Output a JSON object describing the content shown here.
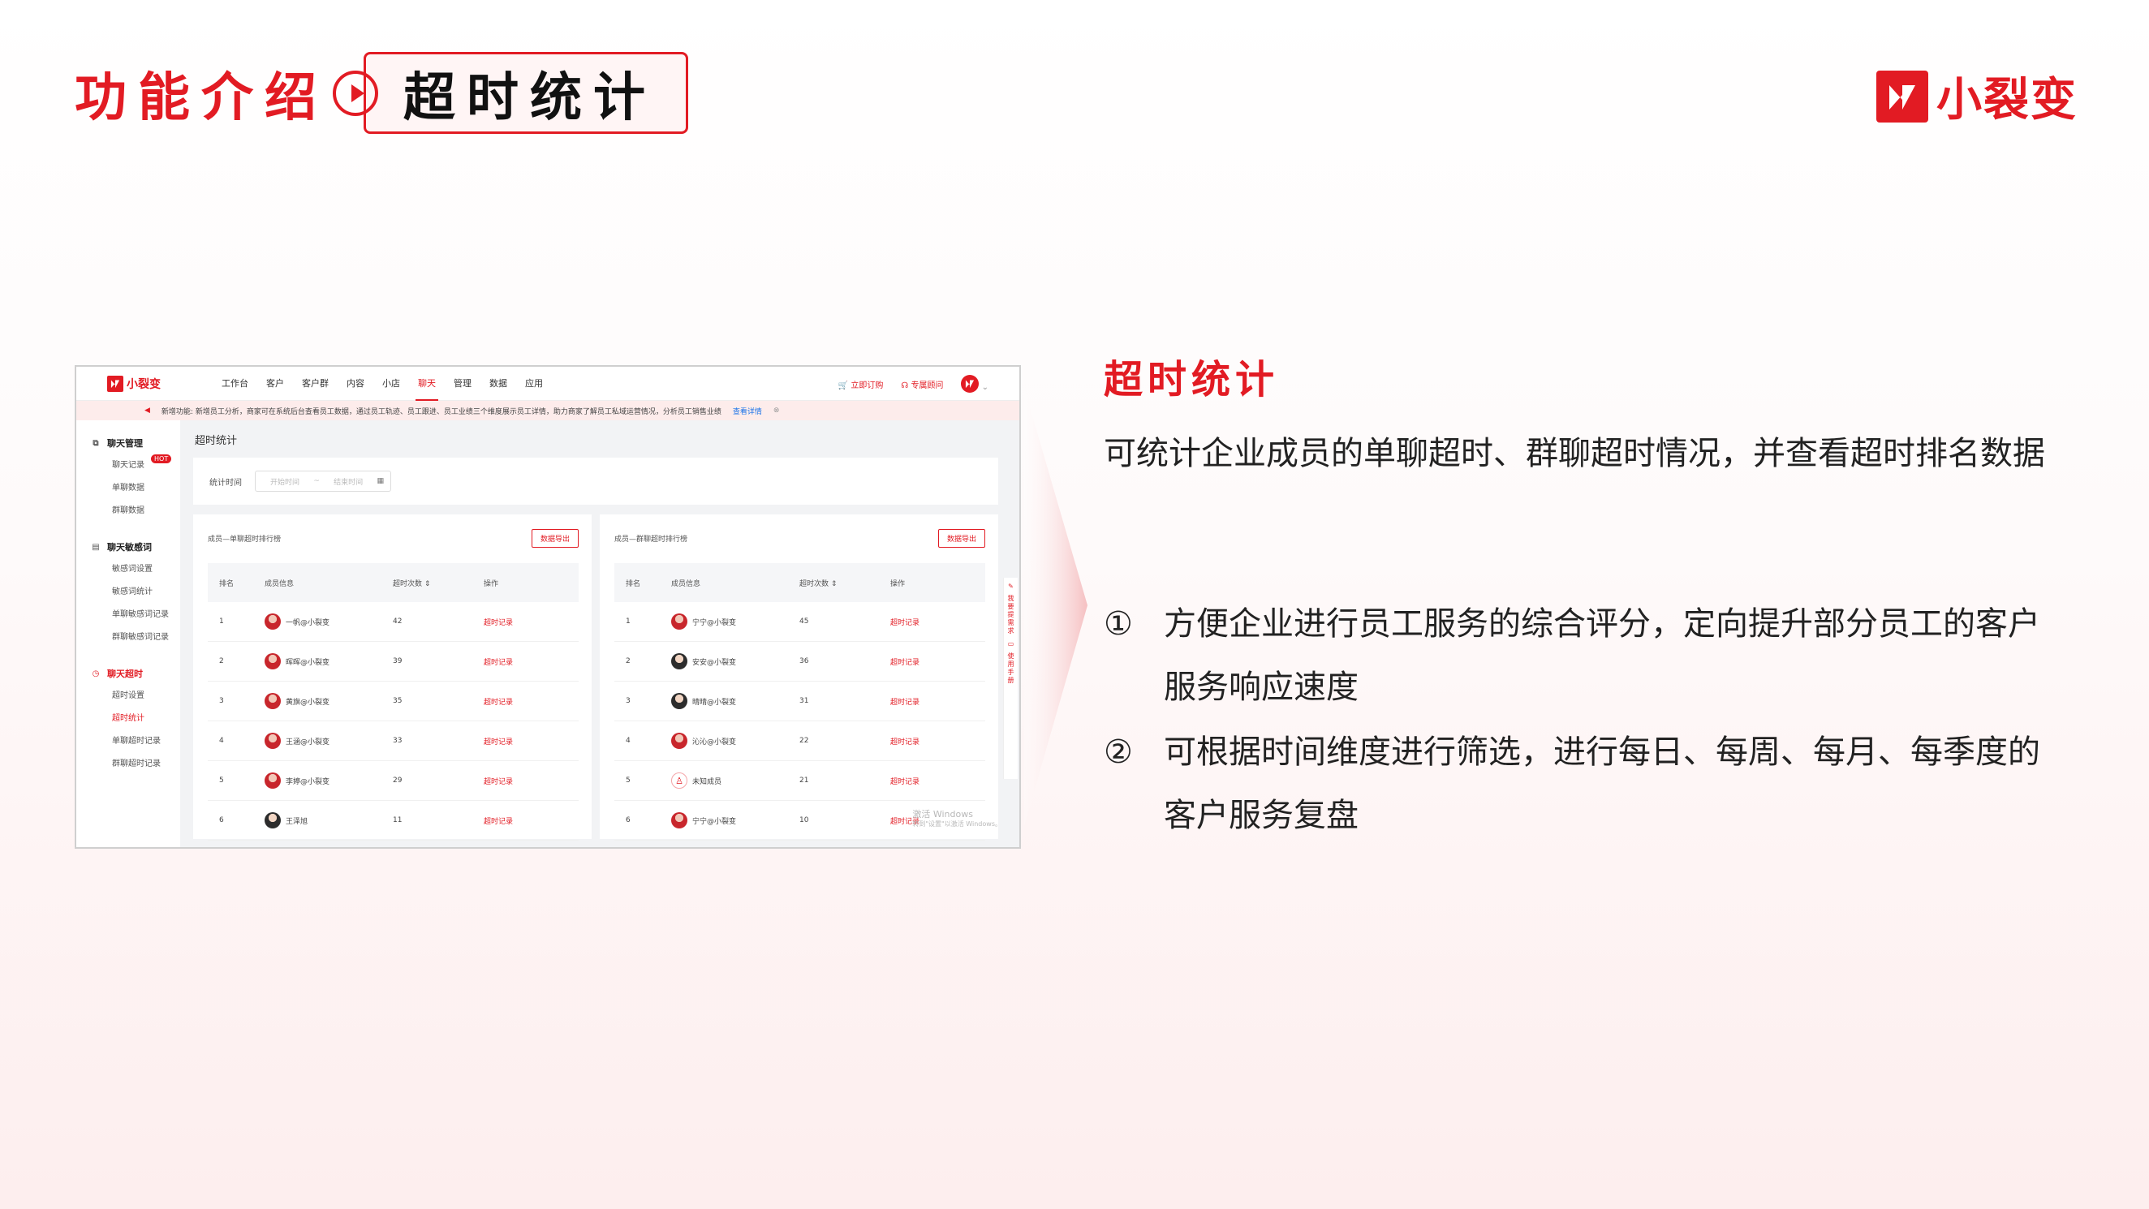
{
  "slide": {
    "title": "功能介绍",
    "subtitle": "超时统计",
    "brand": "小裂变"
  },
  "app": {
    "logo": "小裂变",
    "nav": [
      "工作台",
      "客户",
      "客户群",
      "内容",
      "小店",
      "聊天",
      "管理",
      "数据",
      "应用"
    ],
    "nav_active": "聊天",
    "nav_right": {
      "buy": "立即订购",
      "service": "专属顾问"
    },
    "notice": {
      "text": "新增功能: 新增员工分析，商家可在系统后台查看员工数据，通过员工轨迹、员工跟进、员工业绩三个维度展示员工详情，助力商家了解员工私域运营情况，分析员工销售业绩",
      "link": "查看详情"
    },
    "sidebar": {
      "groups": [
        {
          "label": "聊天管理",
          "icon": "chat-icon",
          "items": [
            {
              "label": "聊天记录",
              "badge": "HOT"
            },
            {
              "label": "单聊数据"
            },
            {
              "label": "群聊数据"
            }
          ]
        },
        {
          "label": "聊天敏感词",
          "icon": "list-icon",
          "items": [
            {
              "label": "敏感词设置"
            },
            {
              "label": "敏感词统计"
            },
            {
              "label": "单聊敏感词记录"
            },
            {
              "label": "群聊敏感词记录"
            }
          ]
        },
        {
          "label": "聊天超时",
          "icon": "clock-icon",
          "items": [
            {
              "label": "超时设置"
            },
            {
              "label": "超时统计"
            },
            {
              "label": "单聊超时记录"
            },
            {
              "label": "群聊超时记录"
            }
          ]
        }
      ],
      "active_item": "超时统计"
    },
    "page_title": "超时统计",
    "filter": {
      "label": "统计时间",
      "start_placeholder": "开始时间",
      "sep": "~",
      "end_placeholder": "结束时间"
    },
    "panels": [
      {
        "title": "成员—单聊超时排行榜",
        "export": "数据导出",
        "columns": [
          "排名",
          "成员信息",
          "超时次数",
          "操作"
        ],
        "rows": [
          {
            "rank": "1",
            "name": "一帆@小裂变",
            "count": "42",
            "action": "超时记录",
            "avatar": "red"
          },
          {
            "rank": "2",
            "name": "晖晖@小裂变",
            "count": "39",
            "action": "超时记录",
            "avatar": "red"
          },
          {
            "rank": "3",
            "name": "黄旗@小裂变",
            "count": "35",
            "action": "超时记录",
            "avatar": "red"
          },
          {
            "rank": "4",
            "name": "王涵@小裂变",
            "count": "33",
            "action": "超时记录",
            "avatar": "red"
          },
          {
            "rank": "5",
            "name": "李婷@小裂变",
            "count": "29",
            "action": "超时记录",
            "avatar": "red"
          },
          {
            "rank": "6",
            "name": "王泽旭",
            "count": "11",
            "action": "超时记录",
            "avatar": "dark"
          }
        ]
      },
      {
        "title": "成员—群聊超时排行榜",
        "export": "数据导出",
        "columns": [
          "排名",
          "成员信息",
          "超时次数",
          "操作"
        ],
        "rows": [
          {
            "rank": "1",
            "name": "宁宁@小裂变",
            "count": "45",
            "action": "超时记录",
            "avatar": "red"
          },
          {
            "rank": "2",
            "name": "安安@小裂变",
            "count": "36",
            "action": "超时记录",
            "avatar": "dark"
          },
          {
            "rank": "3",
            "name": "晴晴@小裂变",
            "count": "31",
            "action": "超时记录",
            "avatar": "dark"
          },
          {
            "rank": "4",
            "name": "沁沁@小裂变",
            "count": "22",
            "action": "超时记录",
            "avatar": "red"
          },
          {
            "rank": "5",
            "name": "未知成员",
            "count": "21",
            "action": "超时记录",
            "avatar": "ghost"
          },
          {
            "rank": "6",
            "name": "宁宁@小裂变",
            "count": "10",
            "action": "超时记录",
            "avatar": "red"
          }
        ]
      }
    ],
    "watermark": {
      "line1": "激活 Windows",
      "line2": "转到\"设置\"以激活 Windows。"
    },
    "float_bar": [
      "我要提需求",
      "使用手册"
    ]
  },
  "feature": {
    "title": "超时统计",
    "description": "可统计企业成员的单聊超时、群聊超时情况，并查看超时排名数据",
    "points": [
      {
        "num": "①",
        "text": "方便企业进行员工服务的综合评分，定向提升部分员工的客户服务响应速度"
      },
      {
        "num": "②",
        "text": "可根据时间维度进行筛选，进行每日、每周、每月、每季度的客户服务复盘"
      }
    ]
  },
  "colors": {
    "accent": "#e21b23",
    "link": "#1a73e8"
  }
}
